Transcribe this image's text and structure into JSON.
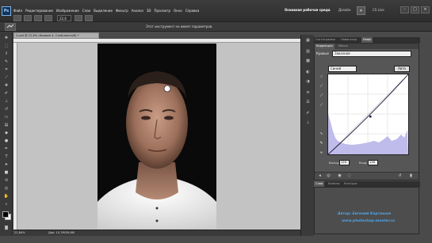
{
  "menubar": {
    "logo": "Ps",
    "items": [
      "Файл",
      "Редактирование",
      "Изображение",
      "Слои",
      "Выделение",
      "Фильтр",
      "Анализ",
      "3D",
      "Просмотр",
      "Окно",
      "Справка"
    ],
    "zoom": "22,6",
    "workspace": "Основная рабочая среда",
    "design": "Дизайн",
    "more": "»",
    "cs_live": "CS Live",
    "win_minimize": "–",
    "win_restore": "□",
    "win_close": "×"
  },
  "options": {
    "message": "Этот инструмент не имеет параметров."
  },
  "document": {
    "tab": "2.psd @ 22,6% (Кривые 4, Слой-маска/8) *",
    "zoom": "22,64%",
    "doc_info": "Док: 10,7M/39,6M"
  },
  "panels": {
    "top_tabs": [
      "Гистограмма",
      "Навигатор",
      "Инфо"
    ],
    "active_top_tab": "Инфо",
    "sub_tabs": [
      "Коррекция",
      "Маски"
    ],
    "curves_label": "Кривые",
    "preset_value": "Заказная",
    "channel_value": "Синий",
    "auto_label": "Авто",
    "input_label": "Вход:",
    "input_value": "138",
    "output_label": "Выход:",
    "output_value": "126",
    "lower_tabs": [
      "Слои",
      "Каналы",
      "Контуры"
    ]
  },
  "credits": {
    "author": "Автор: Евгений Карташов",
    "site": "www.photoshop-master.ru"
  },
  "colors": {
    "curve_line": "#1a1a3a",
    "histogram": "#b8b4e8",
    "credit": "#4ea3e6"
  }
}
